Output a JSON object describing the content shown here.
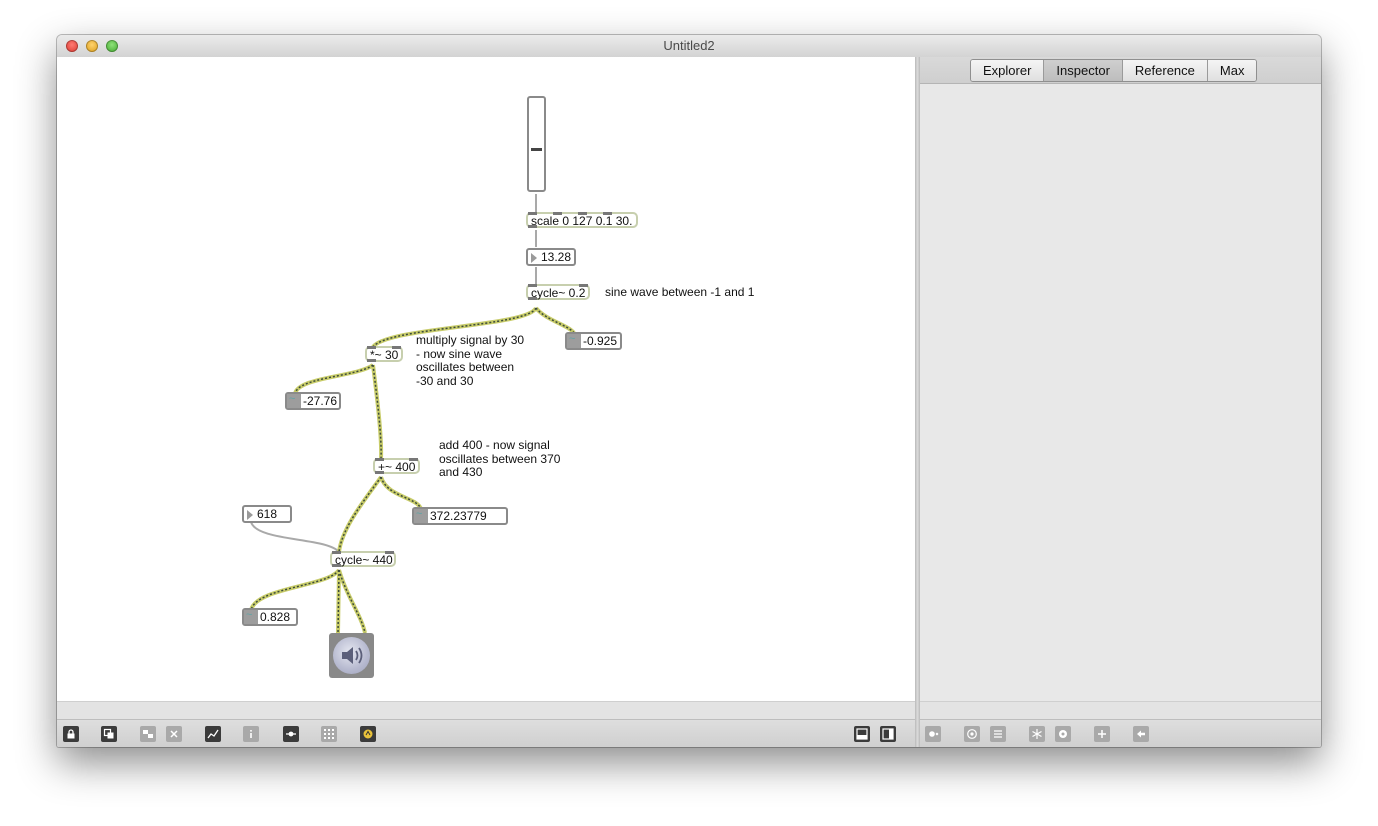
{
  "window": {
    "title": "Untitled2"
  },
  "sidebar": {
    "tabs": [
      {
        "label": "Explorer",
        "active": false
      },
      {
        "label": "Inspector",
        "active": true
      },
      {
        "label": "Reference",
        "active": false
      },
      {
        "label": "Max",
        "active": false
      }
    ]
  },
  "patch": {
    "slider_value_fraction": 0.44,
    "objects": {
      "scale": "scale 0 127 0.1 30.",
      "cycle_lfo": "cycle~ 0.2",
      "mult": "*~ 30",
      "add": "+~ 400",
      "cycle_osc": "cycle~ 440"
    },
    "numbers": {
      "rate": "13.28",
      "freq_in": "618"
    },
    "signals": {
      "lfo_out": "-0.925",
      "mult_out": "-27.76",
      "add_out": "372.23779",
      "osc_out": "0.828"
    },
    "comments": {
      "lfo": "sine wave between -1 and 1",
      "mult": "multiply signal by 30\n- now sine wave\noscillates between\n-30 and 30",
      "add": "add 400 - now signal\noscillates between 370\nand 430"
    }
  },
  "toolbar": {
    "left_icons": [
      "lock-icon",
      "presentation-icon",
      "object-palette-icon",
      "delete-icon",
      "chart-icon",
      "info-icon",
      "slider-icon",
      "grid-icon",
      "audio-dsp-icon"
    ],
    "right_icons": [
      "bottom-panel-icon",
      "side-panel-icon"
    ],
    "sidebar_icons": [
      "settings-icon",
      "at-icon",
      "list-icon",
      "freeze-icon",
      "gear-icon",
      "add-icon",
      "back-icon"
    ]
  },
  "colors": {
    "patch_cord_signal": "#c8cc6a",
    "patch_cord_dash": "#3b4a3b",
    "object_border": "#c7cfae"
  }
}
